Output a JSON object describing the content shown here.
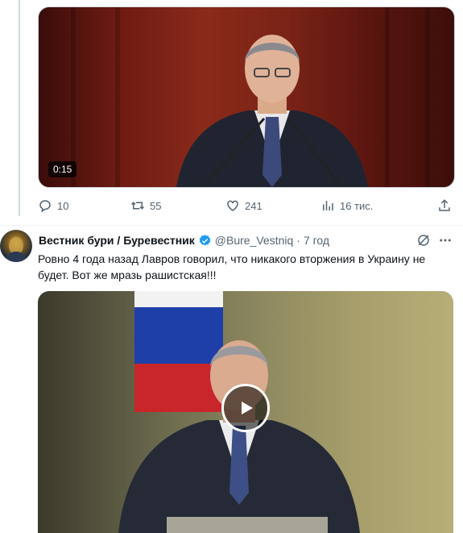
{
  "previous_tweet": {
    "video": {
      "duration": "0:15"
    },
    "actions": {
      "replies": "10",
      "retweets": "55",
      "likes": "241",
      "views": "16 тис."
    }
  },
  "tweet": {
    "author_name": "Вестник бури / Буревестник",
    "verified": true,
    "handle": "@Bure_Vestniq",
    "separator": "·",
    "time": "7 год",
    "text": "Ровно 4 года назад Лавров говорил, что никакого вторжения в Украину не будет. Вот же мразь рашистская!!!"
  },
  "icons": {
    "reply": "reply-icon",
    "retweet": "retweet-icon",
    "like": "heart-icon",
    "views": "views-chart-icon",
    "share": "share-icon",
    "verified": "verified-badge-icon",
    "grok": "grok-icon",
    "more": "more-icon",
    "play": "play-icon"
  },
  "colors": {
    "accent": "#1d9bf0",
    "muted_text": "#536471",
    "text": "#0f1419"
  }
}
